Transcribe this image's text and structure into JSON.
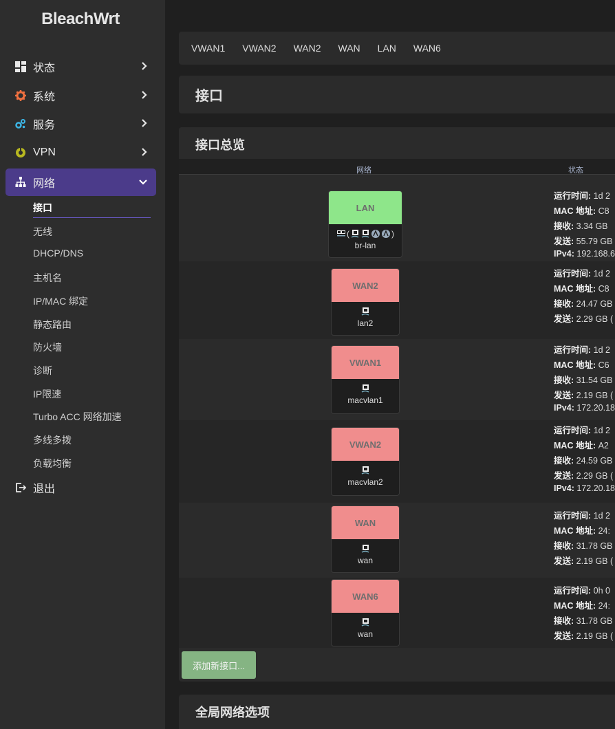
{
  "brand": "BleachWrt",
  "menu": [
    {
      "label": "状态",
      "icon": "dashboard-icon"
    },
    {
      "label": "系统",
      "icon": "gear-icon"
    },
    {
      "label": "服务",
      "icon": "services-icon"
    },
    {
      "label": "VPN",
      "icon": "vpn-icon"
    },
    {
      "label": "网络",
      "icon": "network-icon",
      "expanded": true
    }
  ],
  "submenu": [
    "接口",
    "无线",
    "DHCP/DNS",
    "主机名",
    "IP/MAC 绑定",
    "静态路由",
    "防火墙",
    "诊断",
    "IP限速",
    "Turbo ACC 网络加速",
    "多线多拨",
    "负载均衡"
  ],
  "logout": "退出",
  "tabs": [
    "VWAN1",
    "VWAN2",
    "WAN2",
    "WAN",
    "LAN",
    "WAN6"
  ],
  "page_title": "接口",
  "section_title": "接口总览",
  "columns": {
    "network": "网络",
    "status": "状态"
  },
  "labels": {
    "uptime": "运行时间:",
    "mac": "MAC 地址:",
    "rx": "接收:",
    "tx": "发送:",
    "ipv4": "IPv4:"
  },
  "interfaces": [
    {
      "name": "LAN",
      "device": "br-lan",
      "color": "#8ee68a",
      "uptime": "1d 2",
      "mac": "C8",
      "rx": "3.34 GB",
      "tx": "55.79 GB",
      "ipv4": "192.168.6"
    },
    {
      "name": "WAN2",
      "device": "lan2",
      "color": "#f08d8d",
      "uptime": "1d 2",
      "mac": "C8",
      "rx": "24.47 GB",
      "tx": "2.29 GB (",
      "ipv4": ""
    },
    {
      "name": "VWAN1",
      "device": "macvlan1",
      "color": "#f08d8d",
      "uptime": "1d 2",
      "mac": "C6",
      "rx": "31.54 GB",
      "tx": "2.19 GB (",
      "ipv4": "172.20.18"
    },
    {
      "name": "VWAN2",
      "device": "macvlan2",
      "color": "#f08d8d",
      "uptime": "1d 2",
      "mac": "A2",
      "rx": "24.59 GB",
      "tx": "2.29 GB (",
      "ipv4": "172.20.18"
    },
    {
      "name": "WAN",
      "device": "wan",
      "color": "#f08d8d",
      "uptime": "1d 2",
      "mac": "24:",
      "rx": "31.78 GB",
      "tx": "2.19 GB (",
      "ipv4": ""
    },
    {
      "name": "WAN6",
      "device": "wan",
      "color": "#f08d8d",
      "uptime": "0h 0",
      "mac": "24:",
      "rx": "31.78 GB",
      "tx": "2.19 GB (",
      "ipv4": ""
    }
  ],
  "add_button": "添加新接口...",
  "global_title": "全局网络选项"
}
